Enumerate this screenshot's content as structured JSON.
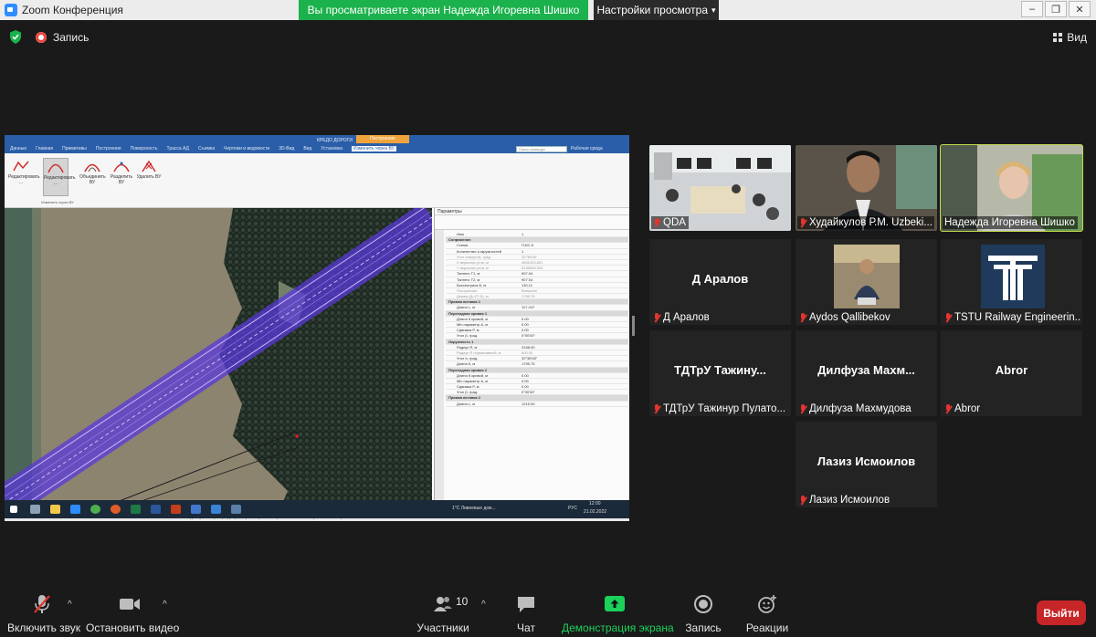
{
  "window": {
    "title": "Zoom Конференция",
    "share_banner": "Вы просматриваете экран Надежда Игоревна Шишко",
    "view_options": "Настройки просмотра",
    "controls": [
      "–",
      "❐",
      "✕"
    ]
  },
  "meeting": {
    "recording_label": "Запись",
    "view_label": "Вид"
  },
  "shared_app": {
    "doc_title": "КРЕДО ДОРОГИ",
    "context_tab": "Построение",
    "tabs": [
      "Данные",
      "Главная",
      "Примитивы",
      "Построения",
      "Поверхность",
      "Трасса АД",
      "Съемка",
      "Чертежи и ведомости",
      "3D-Вид",
      "Вид",
      "Установка",
      "Изменить через ВУ"
    ],
    "search_placeholder": "Поиск команды",
    "workspace_label": "Рабочая среда",
    "ribbon_buttons": [
      "Редактировать ...",
      "Редактировать ...",
      "Объединить ВУ",
      "Разделить ВУ",
      "Удалить ВУ"
    ],
    "ribbon_group": "Изменить через ВУ",
    "params_title": "Параметры",
    "params_rows": [
      {
        "k": "Имя",
        "v": "1",
        "type": "row"
      },
      {
        "k": "Сопряжение",
        "v": "",
        "type": "sec"
      },
      {
        "k": "Схема",
        "v": "П-КС-К",
        "type": "row"
      },
      {
        "k": "Количество к.окружностей",
        "v": "1",
        "type": "row"
      },
      {
        "k": "Угол поворота, град.",
        "v": "32°38'08\"",
        "type": "dim"
      },
      {
        "k": "X вершины угла, м",
        "v": "4651003.851",
        "type": "dim"
      },
      {
        "k": "Y вершины угла, м",
        "v": "6135828.004",
        "type": "dim"
      },
      {
        "k": "Тангенс Т1, м",
        "v": "907.04",
        "type": "row"
      },
      {
        "k": "Тангенс Т2, м",
        "v": "907.04",
        "type": "row"
      },
      {
        "k": "Биссектриса Б, м",
        "v": "130.11",
        "type": "row"
      },
      {
        "k": "Построение",
        "v": "Внешнее",
        "type": "dim"
      },
      {
        "k": "Домер (Д=2Т-Л), м",
        "v": "1795.75",
        "type": "dim"
      },
      {
        "k": "Прямая вставка 1",
        "v": "",
        "type": "sec"
      },
      {
        "k": "Длина L, м",
        "v": "117.247",
        "type": "row"
      },
      {
        "k": "Переходная кривая 1",
        "v": "",
        "type": "sec"
      },
      {
        "k": "Длина К кривой, м",
        "v": "0.00",
        "type": "row"
      },
      {
        "k": "Min параметр A, м",
        "v": "0.00",
        "type": "row"
      },
      {
        "k": "Сдвижка P, м",
        "v": "0.00",
        "type": "row"
      },
      {
        "k": "Угол β, град.",
        "v": "0°00'00\"",
        "type": "row"
      },
      {
        "k": "Окружность 1",
        "v": "",
        "type": "sec"
      },
      {
        "k": "Радиус R, м",
        "v": "3158.00",
        "type": "row"
      },
      {
        "k": "Радиус R нормативный, м",
        "v": "600.00",
        "type": "dim"
      },
      {
        "k": "Угол α, град.",
        "v": "32°38'08\"",
        "type": "row"
      },
      {
        "k": "Длина К, м",
        "v": "1795.75",
        "type": "row"
      },
      {
        "k": "Переходная кривая 2",
        "v": "",
        "type": "sec"
      },
      {
        "k": "Длина К кривой, м",
        "v": "0.00",
        "type": "row"
      },
      {
        "k": "Min параметр A, м",
        "v": "0.00",
        "type": "row"
      },
      {
        "k": "Сдвижка P, м",
        "v": "0.00",
        "type": "row"
      },
      {
        "k": "Угол β, град.",
        "v": "0°00'00\"",
        "type": "row"
      },
      {
        "k": "Прямая вставка 2",
        "v": "",
        "type": "sec"
      },
      {
        "k": "Длина L, м",
        "v": "1215.00",
        "type": "row"
      }
    ],
    "status": [
      "План",
      "X=4651039.651 м",
      "Y=6135969.741 м",
      "1:1977",
      "1:2000",
      "Редактировать Трассу АД через Вершины углов поворота",
      "Новый узел",
      "Укрыть"
    ],
    "status_right": "1995 поле 0",
    "taskbar_weather": "1°C Ливневые дож...",
    "taskbar_lang": "РУС",
    "taskbar_time": "12:00",
    "taskbar_date": "21.02.2022"
  },
  "participants": [
    {
      "id": "qda",
      "label": "QDA",
      "display_name": ""
    },
    {
      "id": "khudaykulov",
      "label": "Худайкулов Р.М. Uzbeki...",
      "display_name": ""
    },
    {
      "id": "shishko",
      "label": "Надежда Игоревна Шишко",
      "display_name": ""
    },
    {
      "id": "aralov",
      "label": "Д Аралов",
      "display_name": "Д Аралов"
    },
    {
      "id": "aydos",
      "label": "Aydos Qallibekov",
      "display_name": ""
    },
    {
      "id": "tstu",
      "label": "TSTU Railway Engineerin...",
      "display_name": ""
    },
    {
      "id": "tazhinur",
      "label": "ТДТрУ Тажинур Пулато...",
      "display_name": "ТДТрУ Тажину..."
    },
    {
      "id": "dilfuza",
      "label": "Дилфуза Махмудова",
      "display_name": "Дилфуза  Махм..."
    },
    {
      "id": "abror",
      "label": "Abror",
      "display_name": "Abror"
    },
    {
      "id": "laziz",
      "label": "Лазиз Исмоилов",
      "display_name": "Лазиз Исмоилов"
    }
  ],
  "toolbar": {
    "mute": "Включить звук",
    "video": "Остановить видео",
    "participants": "Участники",
    "participants_count": "10",
    "chat": "Чат",
    "share": "Демонстрация экрана",
    "record": "Запись",
    "reactions": "Реакции",
    "leave": "Выйти"
  },
  "colors": {
    "banner_green": "#1bb14c",
    "leave_red": "#c72629",
    "active_speaker": "#c3d94a",
    "ribbon_blue": "#2a5ea8",
    "route_purple": "#6a2be0"
  }
}
